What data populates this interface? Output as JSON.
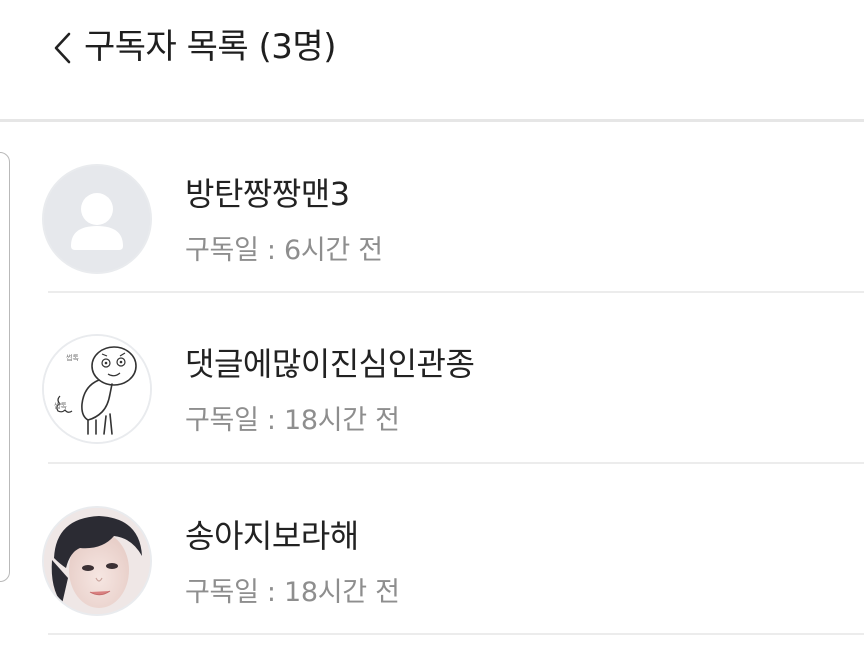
{
  "header": {
    "back_icon": "chevron-left-icon",
    "title": "구독자 목록 (3명)"
  },
  "subscribers": [
    {
      "name": "방탄짱짱맨3",
      "subscribed": "구독일 : 6시간 전",
      "avatar": "default-user-icon"
    },
    {
      "name": "댓글에많이진심인관종",
      "subscribed": "구독일 : 18시간 전",
      "avatar": "cartoon-character-avatar"
    },
    {
      "name": "송아지보라해",
      "subscribed": "구독일 : 18시간 전",
      "avatar": "profile-photo-avatar"
    }
  ],
  "colors": {
    "title": "#1f1f1f",
    "name": "#222222",
    "meta": "#8e8e8e",
    "divider": "#ececec",
    "default_avatar_bg": "#e6e8ec"
  }
}
